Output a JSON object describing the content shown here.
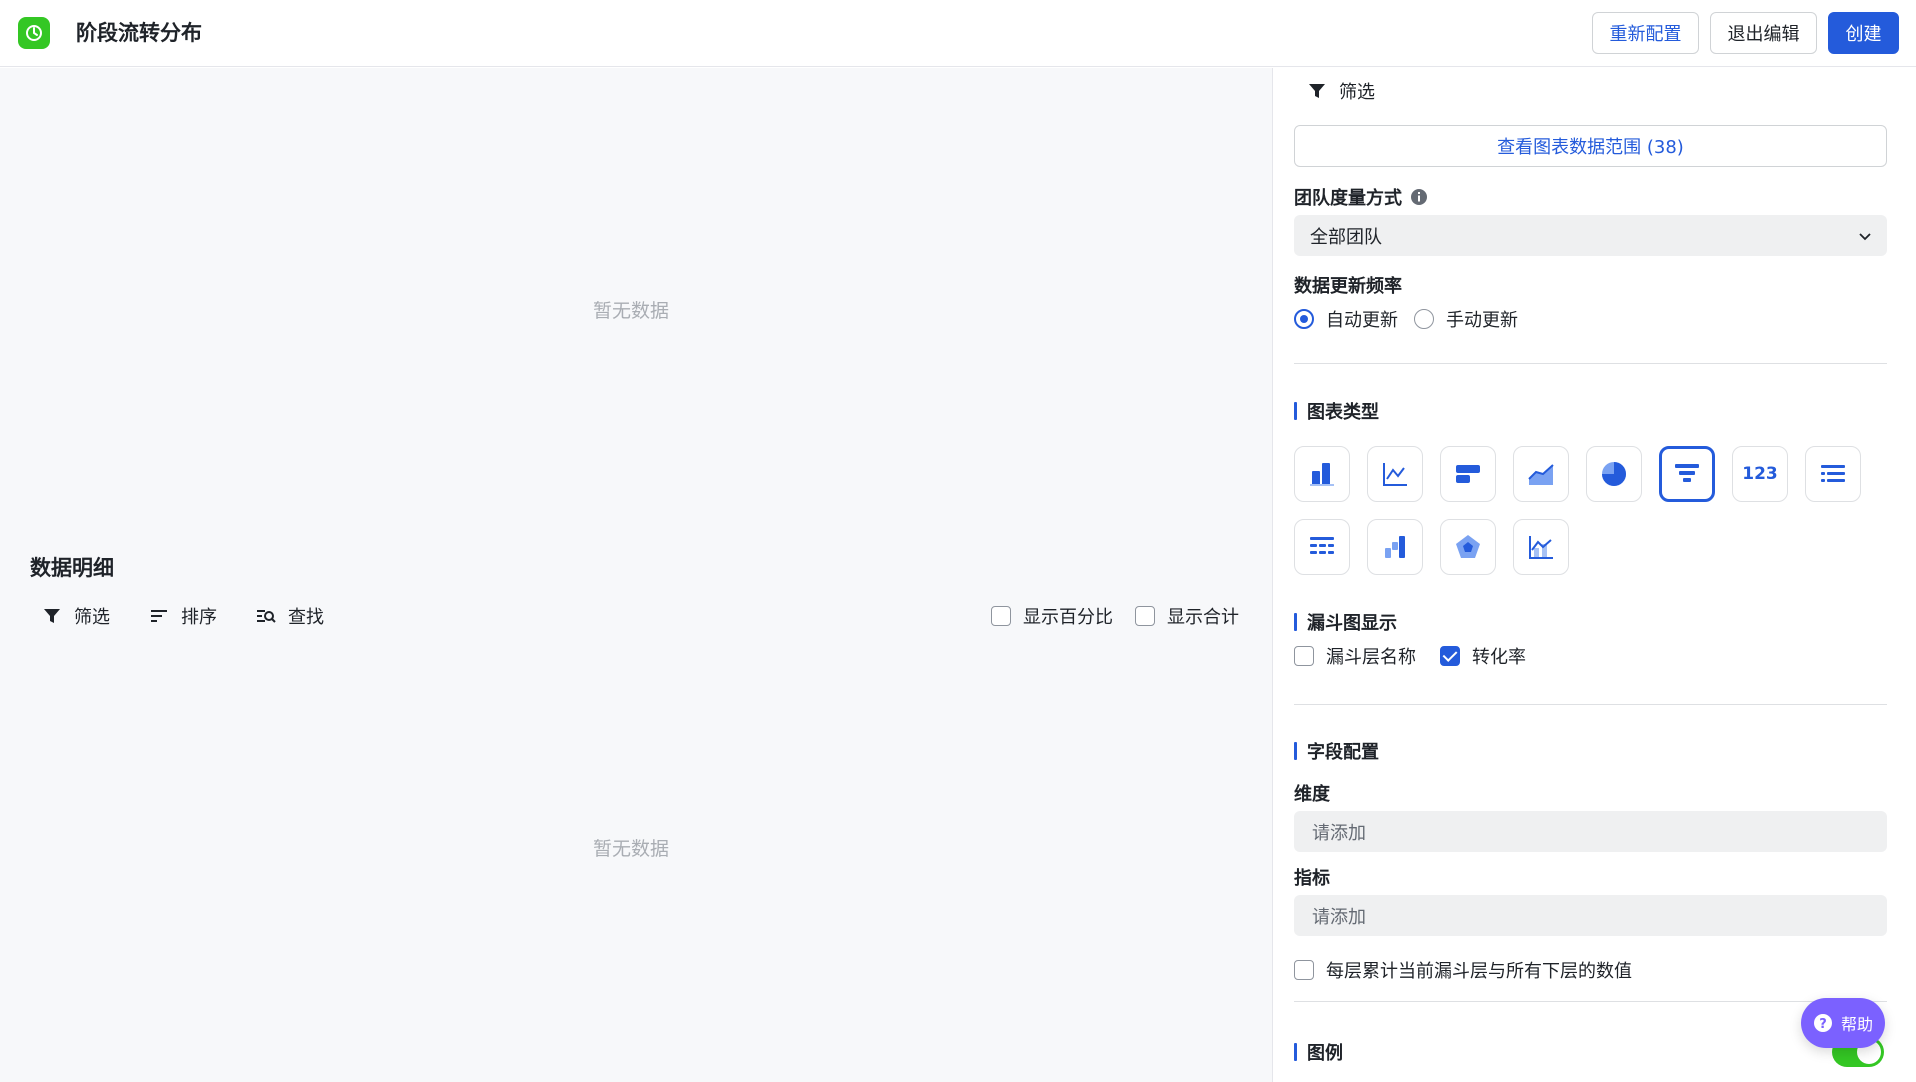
{
  "header": {
    "title": "阶段流转分布",
    "buttons": {
      "reconfigure": "重新配置",
      "exit_edit": "退出编辑",
      "create": "创建"
    }
  },
  "main": {
    "chart_empty": "暂无数据",
    "detail_title": "数据明细",
    "toolbar": {
      "filter": "筛选",
      "sort": "排序",
      "find": "查找",
      "show_percent": "显示百分比",
      "show_total": "显示合计"
    },
    "table_empty": "暂无数据"
  },
  "panel": {
    "filter_label": "筛选",
    "range_button": "查看图表数据范围 (38)",
    "team_measure": {
      "label": "团队度量方式",
      "value": "全部团队"
    },
    "update_freq": {
      "label": "数据更新频率",
      "options": [
        "自动更新",
        "手动更新"
      ],
      "selected": "自动更新"
    },
    "chart_type": {
      "title": "图表类型",
      "types": [
        "column-chart-icon",
        "line-chart-icon",
        "bar-chart-icon",
        "area-chart-icon",
        "pie-chart-icon",
        "funnel-chart-icon",
        "number-card-icon",
        "list-icon",
        "pivot-table-icon",
        "waterfall-chart-icon",
        "radar-chart-icon",
        "combo-chart-icon"
      ],
      "selected": "funnel-chart-icon",
      "number_label": "123"
    },
    "funnel_display": {
      "title": "漏斗图显示",
      "layer_name": "漏斗层名称",
      "conversion_rate": "转化率",
      "layer_name_checked": false,
      "conversion_rate_checked": true
    },
    "field_config": {
      "title": "字段配置",
      "dimension_label": "维度",
      "dimension_placeholder": "请添加",
      "metric_label": "指标",
      "metric_placeholder": "请添加",
      "cumulative_label": "每层累计当前漏斗层与所有下层的数值"
    },
    "legend": {
      "title": "图例",
      "enabled": true
    }
  },
  "help": {
    "label": "帮助"
  },
  "colors": {
    "primary": "#245bdb",
    "brand_green": "#34c724",
    "help_purple": "#7b61ff"
  }
}
